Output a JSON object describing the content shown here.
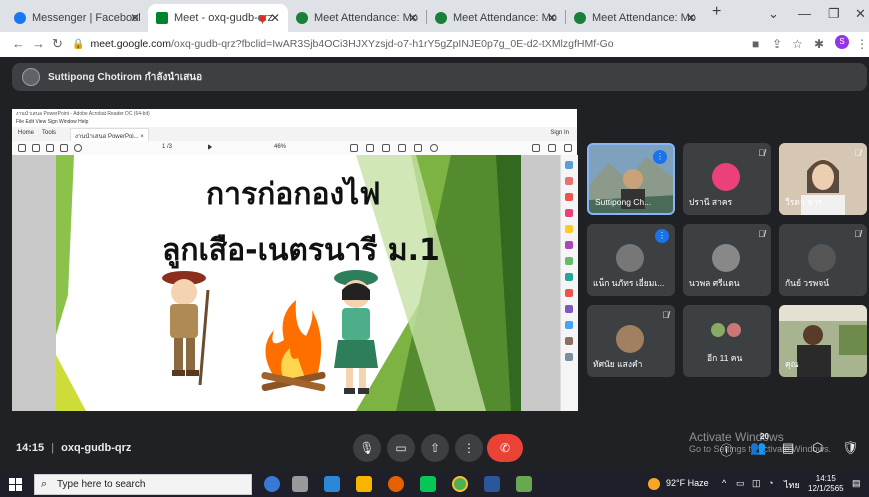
{
  "browser": {
    "tabs": [
      {
        "label": "Messenger | Facebook",
        "icon": "facebook-icon",
        "color": "#1877f2"
      },
      {
        "label": "Meet - oxq-gudb-qrz",
        "icon": "meet-icon",
        "color": "#00832d",
        "active": true
      },
      {
        "label": "Meet Attendance: Monitor",
        "icon": "extension-icon",
        "color": "#188038"
      },
      {
        "label": "Meet Attendance: Monitor",
        "icon": "extension-icon",
        "color": "#188038"
      },
      {
        "label": "Meet Attendance: Monitor",
        "icon": "extension-icon",
        "color": "#188038"
      }
    ],
    "url_host": "meet.google.com",
    "url_rest": "/oxq-gudb-qrz?fbclid=IwAR3Sjb4OCi3HJXYzsjd-o7-h1rY5gZpINJE0p7g_0E-d2-tXMlzgfHMf-Go",
    "profile_initial": "S"
  },
  "meet": {
    "presenter_banner": "Suttipong Chotirom กำลังนำเสนอ",
    "slide": {
      "title_line1": "การก่อกองไฟ",
      "title_line2": "ลูกเสือ-เนตรนารี ม.1",
      "acrobat_title": "งานนำเสนอ PowerPoint - Adobe Acrobat Reader DC (64-bit)",
      "acrobat_menu": "File  Edit  View  Sign  Window  Help",
      "acrobat_tab_home": "Home",
      "acrobat_tab_tools": "Tools",
      "acrobat_tab_doc": "งานนำเสนอ PowerPoi... ×",
      "acrobat_signin": "Sign In",
      "acrobat_page": "1  /3",
      "acrobat_zoom": "46%"
    },
    "participants": [
      {
        "name": "Suttipong Ch...",
        "state": "speaking",
        "bg": "#6b8fa8",
        "avatar": "#c9a27a"
      },
      {
        "name": "ปรานี สาคร",
        "state": "muted",
        "bg": "#3c4043",
        "avatar": "#ec407a"
      },
      {
        "name": "วีรดา ชาร...",
        "state": "muted",
        "bg": "#c9b8a6",
        "avatar": "#e0c4a8"
      },
      {
        "name": "แน็ก นภัทร เอี่ยมเ...",
        "state": "speaking",
        "bg": "#3c4043",
        "avatar": "#777"
      },
      {
        "name": "นวพล ศรีแดน",
        "state": "muted",
        "bg": "#3c4043",
        "avatar": "#888"
      },
      {
        "name": "กันย์ วรพจน์",
        "state": "muted",
        "bg": "#3c4043",
        "avatar": "#555"
      },
      {
        "name": "ทัศนัย แสงคำ",
        "state": "muted",
        "bg": "#3c4043",
        "avatar": "#a08060"
      },
      {
        "name": "อีก 11 คน",
        "state": "none",
        "bg": "#3c4043",
        "avatar": "#8a6"
      },
      {
        "name": "คุณ",
        "state": "none",
        "bg": "#7a8a6a",
        "avatar": "#5a3a2a"
      }
    ],
    "meeting_time": "14:15",
    "meeting_code": "oxq-gudb-qrz",
    "participant_count": "20",
    "watermark_line1": "Activate Windows",
    "watermark_line2": "Go to Settings to activate Windows."
  },
  "taskbar": {
    "search_placeholder": "Type here to search",
    "weather": "92°F  Haze",
    "lang": "ไทย",
    "time": "14:15",
    "date": "12/1/2565"
  }
}
